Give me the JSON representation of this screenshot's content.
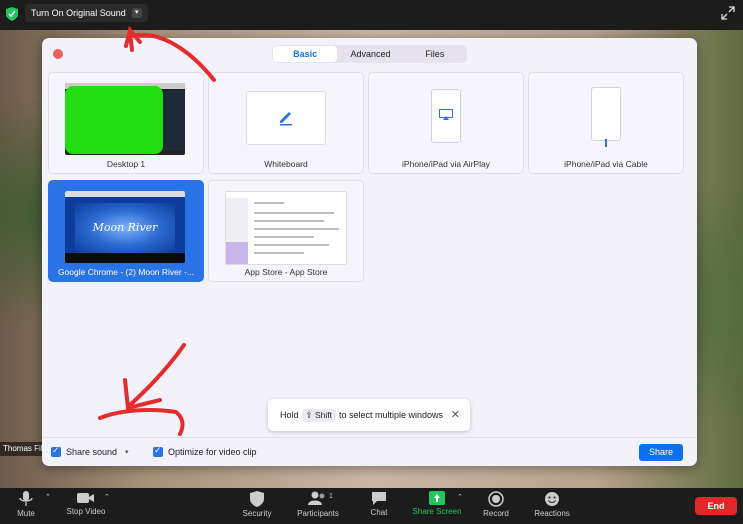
{
  "topbar": {
    "original_sound_label": "Turn On Original Sound",
    "caret": "▾"
  },
  "background": {
    "participant_name": "Thomas Fil"
  },
  "dialog": {
    "tabs": [
      {
        "label": "Basic",
        "active": true
      },
      {
        "label": "Advanced",
        "active": false
      },
      {
        "label": "Files",
        "active": false
      }
    ],
    "tiles": [
      {
        "label": "Desktop 1"
      },
      {
        "label": "Whiteboard"
      },
      {
        "label": "iPhone/iPad via AirPlay"
      },
      {
        "label": "iPhone/iPad via Cable"
      },
      {
        "label": "Google Chrome - (2) Moon River -...",
        "selected": true
      },
      {
        "label": "App Store - App Store"
      }
    ],
    "chrome_thumb_title": "Moon River",
    "tooltip": {
      "hold": "Hold",
      "key": "⇧ Shift",
      "rest": "to select multiple windows",
      "close": "✕"
    },
    "footer": {
      "share_sound_label": "Share sound",
      "share_sound_caret": "▾",
      "optimize_label": "Optimize for video clip",
      "share_button": "Share"
    }
  },
  "toolbar": {
    "mute": "Mute",
    "stop_video": "Stop Video",
    "security": "Security",
    "participants": "Participants",
    "participants_count": "1",
    "chat": "Chat",
    "share_screen": "Share Screen",
    "record": "Record",
    "reactions": "Reactions",
    "end": "End"
  },
  "colors": {
    "accent": "#0e71eb",
    "selected_tile": "#2a73e6",
    "share_screen_green": "#22c55e",
    "end_red": "#e02828"
  }
}
